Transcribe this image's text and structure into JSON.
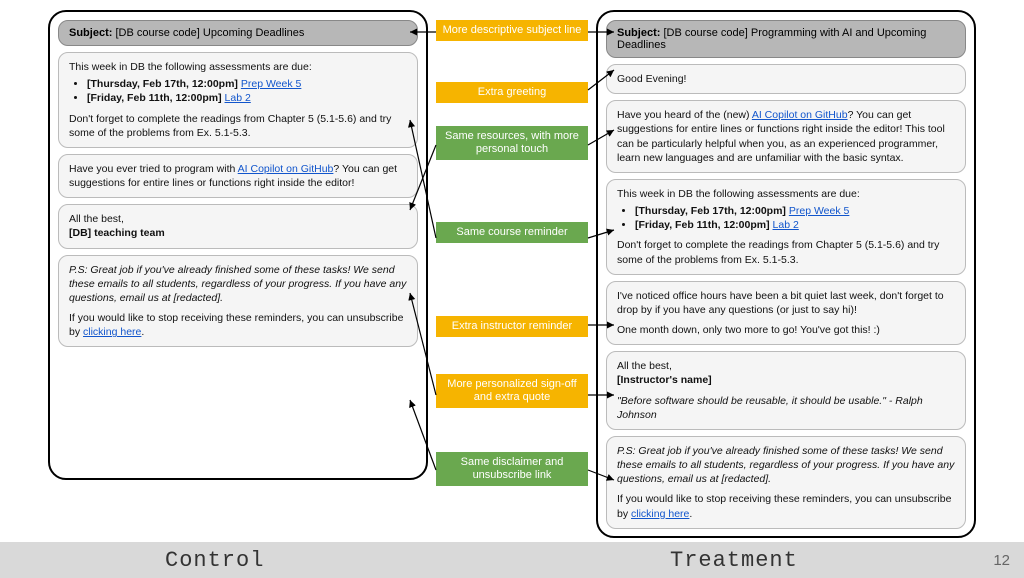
{
  "control": {
    "subject_prefix": "Subject:",
    "subject_text": "[DB course code] Upcoming Deadlines",
    "reminder_intro": "This week in DB the following assessments are due:",
    "reminder_items": [
      {
        "bold": "[Thursday, Feb 17th, 12:00pm]",
        "link": "Prep Week 5 "
      },
      {
        "bold": "[Friday, Feb 11th, 12:00pm]",
        "link": "Lab 2"
      }
    ],
    "reminder_note": "Don't forget to complete the readings from Chapter 5 (5.1-5.6) and try some of the problems from Ex. 5.1-5.3.",
    "resource_pre": "Have you ever tried to program with ",
    "resource_link": "AI Copilot on GitHub",
    "resource_post": "? You can get suggestions for entire lines or functions right inside the editor!",
    "signoff_line1": "All the best,",
    "signoff_line2": "[DB] teaching team",
    "ps_text": "P.S: Great job if you've already finished some of these tasks! We send these emails to all students, regardless of your progress. If you have any questions, email us at [redacted].",
    "unsub_pre": "If you would like to stop receiving these reminders, you can unsubscribe by ",
    "unsub_link": "clicking here",
    "unsub_post": "."
  },
  "treatment": {
    "subject_prefix": "Subject:",
    "subject_text": "[DB course code] Programming with AI and Upcoming Deadlines",
    "greeting": "Good Evening!",
    "resource_pre": "Have you heard of the (new) ",
    "resource_link": "AI Copilot on GitHub",
    "resource_post": "? You can get suggestions for entire lines or functions right inside the editor! This tool can be particularly helpful when you, as an experienced programmer,  learn new languages and are unfamiliar with the basic syntax.",
    "reminder_intro": "This week in DB the following assessments are due:",
    "reminder_items": [
      {
        "bold": "[Thursday, Feb 17th, 12:00pm]",
        "link": "Prep Week 5 "
      },
      {
        "bold": "[Friday, Feb 11th, 12:00pm]",
        "link": "Lab 2"
      }
    ],
    "reminder_note": "Don't forget to complete the readings from Chapter 5 (5.1-5.6) and try some of the problems from Ex. 5.1-5.3.",
    "instructor1": "I've noticed office hours have been a bit quiet last week, don't forget to drop by if you have any questions (or just to say hi)!",
    "instructor2": "One month down, only two more to go! You've got this! :)",
    "signoff_line1": "All the best,",
    "signoff_line2": "[Instructor's name]",
    "signoff_quote": "\"Before software should be reusable, it should be usable.\" - Ralph Johnson",
    "ps_text": "P.S: Great job if you've already finished some of these tasks! We send these emails to all students, regardless of your progress. If you have any questions, email us at [redacted].",
    "unsub_pre": "If you would like to stop receiving these reminders, you can unsubscribe by ",
    "unsub_link": "clicking here",
    "unsub_post": "."
  },
  "badges": {
    "b1": "More descriptive subject line",
    "b2": "Extra greeting",
    "b3": "Same resources, with more personal touch",
    "b4": "Same course reminder",
    "b5": "Extra instructor reminder",
    "b6": "More personalized sign-off and extra quote",
    "b7": "Same disclaimer and unsubscribe link"
  },
  "footer": {
    "control": "Control",
    "treatment": "Treatment",
    "page": "12"
  }
}
